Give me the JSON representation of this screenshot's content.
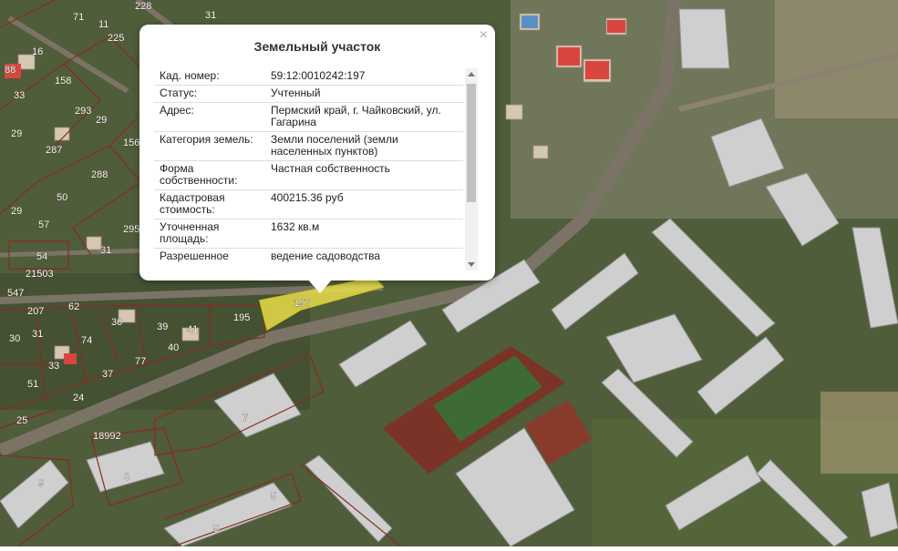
{
  "map": {
    "colors": {
      "vegetation": "#4f5d3a",
      "cadastral_line": "#8a2a24",
      "selected_fill": "#f0e64a",
      "road": "#7b7466",
      "roof": "#cfcfcf",
      "field": "#3e6b35",
      "track": "#7a3326"
    },
    "plot_labels": [
      "71",
      "11",
      "225",
      "228",
      "31",
      "16",
      "88",
      "158",
      "33",
      "293",
      "29",
      "29",
      "156",
      "287",
      "288",
      "50",
      "295",
      "29",
      "57",
      "54",
      "31",
      "21503",
      "547",
      "62",
      "207",
      "36",
      "39",
      "41",
      "195",
      "197",
      "30",
      "31",
      "74",
      "33",
      "40",
      "77",
      "51",
      "37",
      "24",
      "25",
      "18992",
      "7",
      "6",
      "9",
      "5",
      "5"
    ],
    "selected_plot_label": "197"
  },
  "popup": {
    "title": "Земельный участок",
    "close_glyph": "×",
    "rows": [
      {
        "key": "Кад. номер:",
        "value": "59:12:0010242:197"
      },
      {
        "key": "Статус:",
        "value": "Учтенный"
      },
      {
        "key": "Адрес:",
        "value": "Пермский край, г. Чайковский, ул. Гагарина"
      },
      {
        "key": "Категория земель:",
        "value": "Земли поселений (земли населенных пунктов)"
      },
      {
        "key": "Форма собственности:",
        "value": "Частная собственность"
      },
      {
        "key": "Кадастровая стоимость:",
        "value": "400215.36 руб"
      },
      {
        "key": "Уточненная площадь:",
        "value": "1632 кв.м"
      },
      {
        "key": "Разрешенное",
        "value": "ведение садоводства"
      }
    ]
  }
}
